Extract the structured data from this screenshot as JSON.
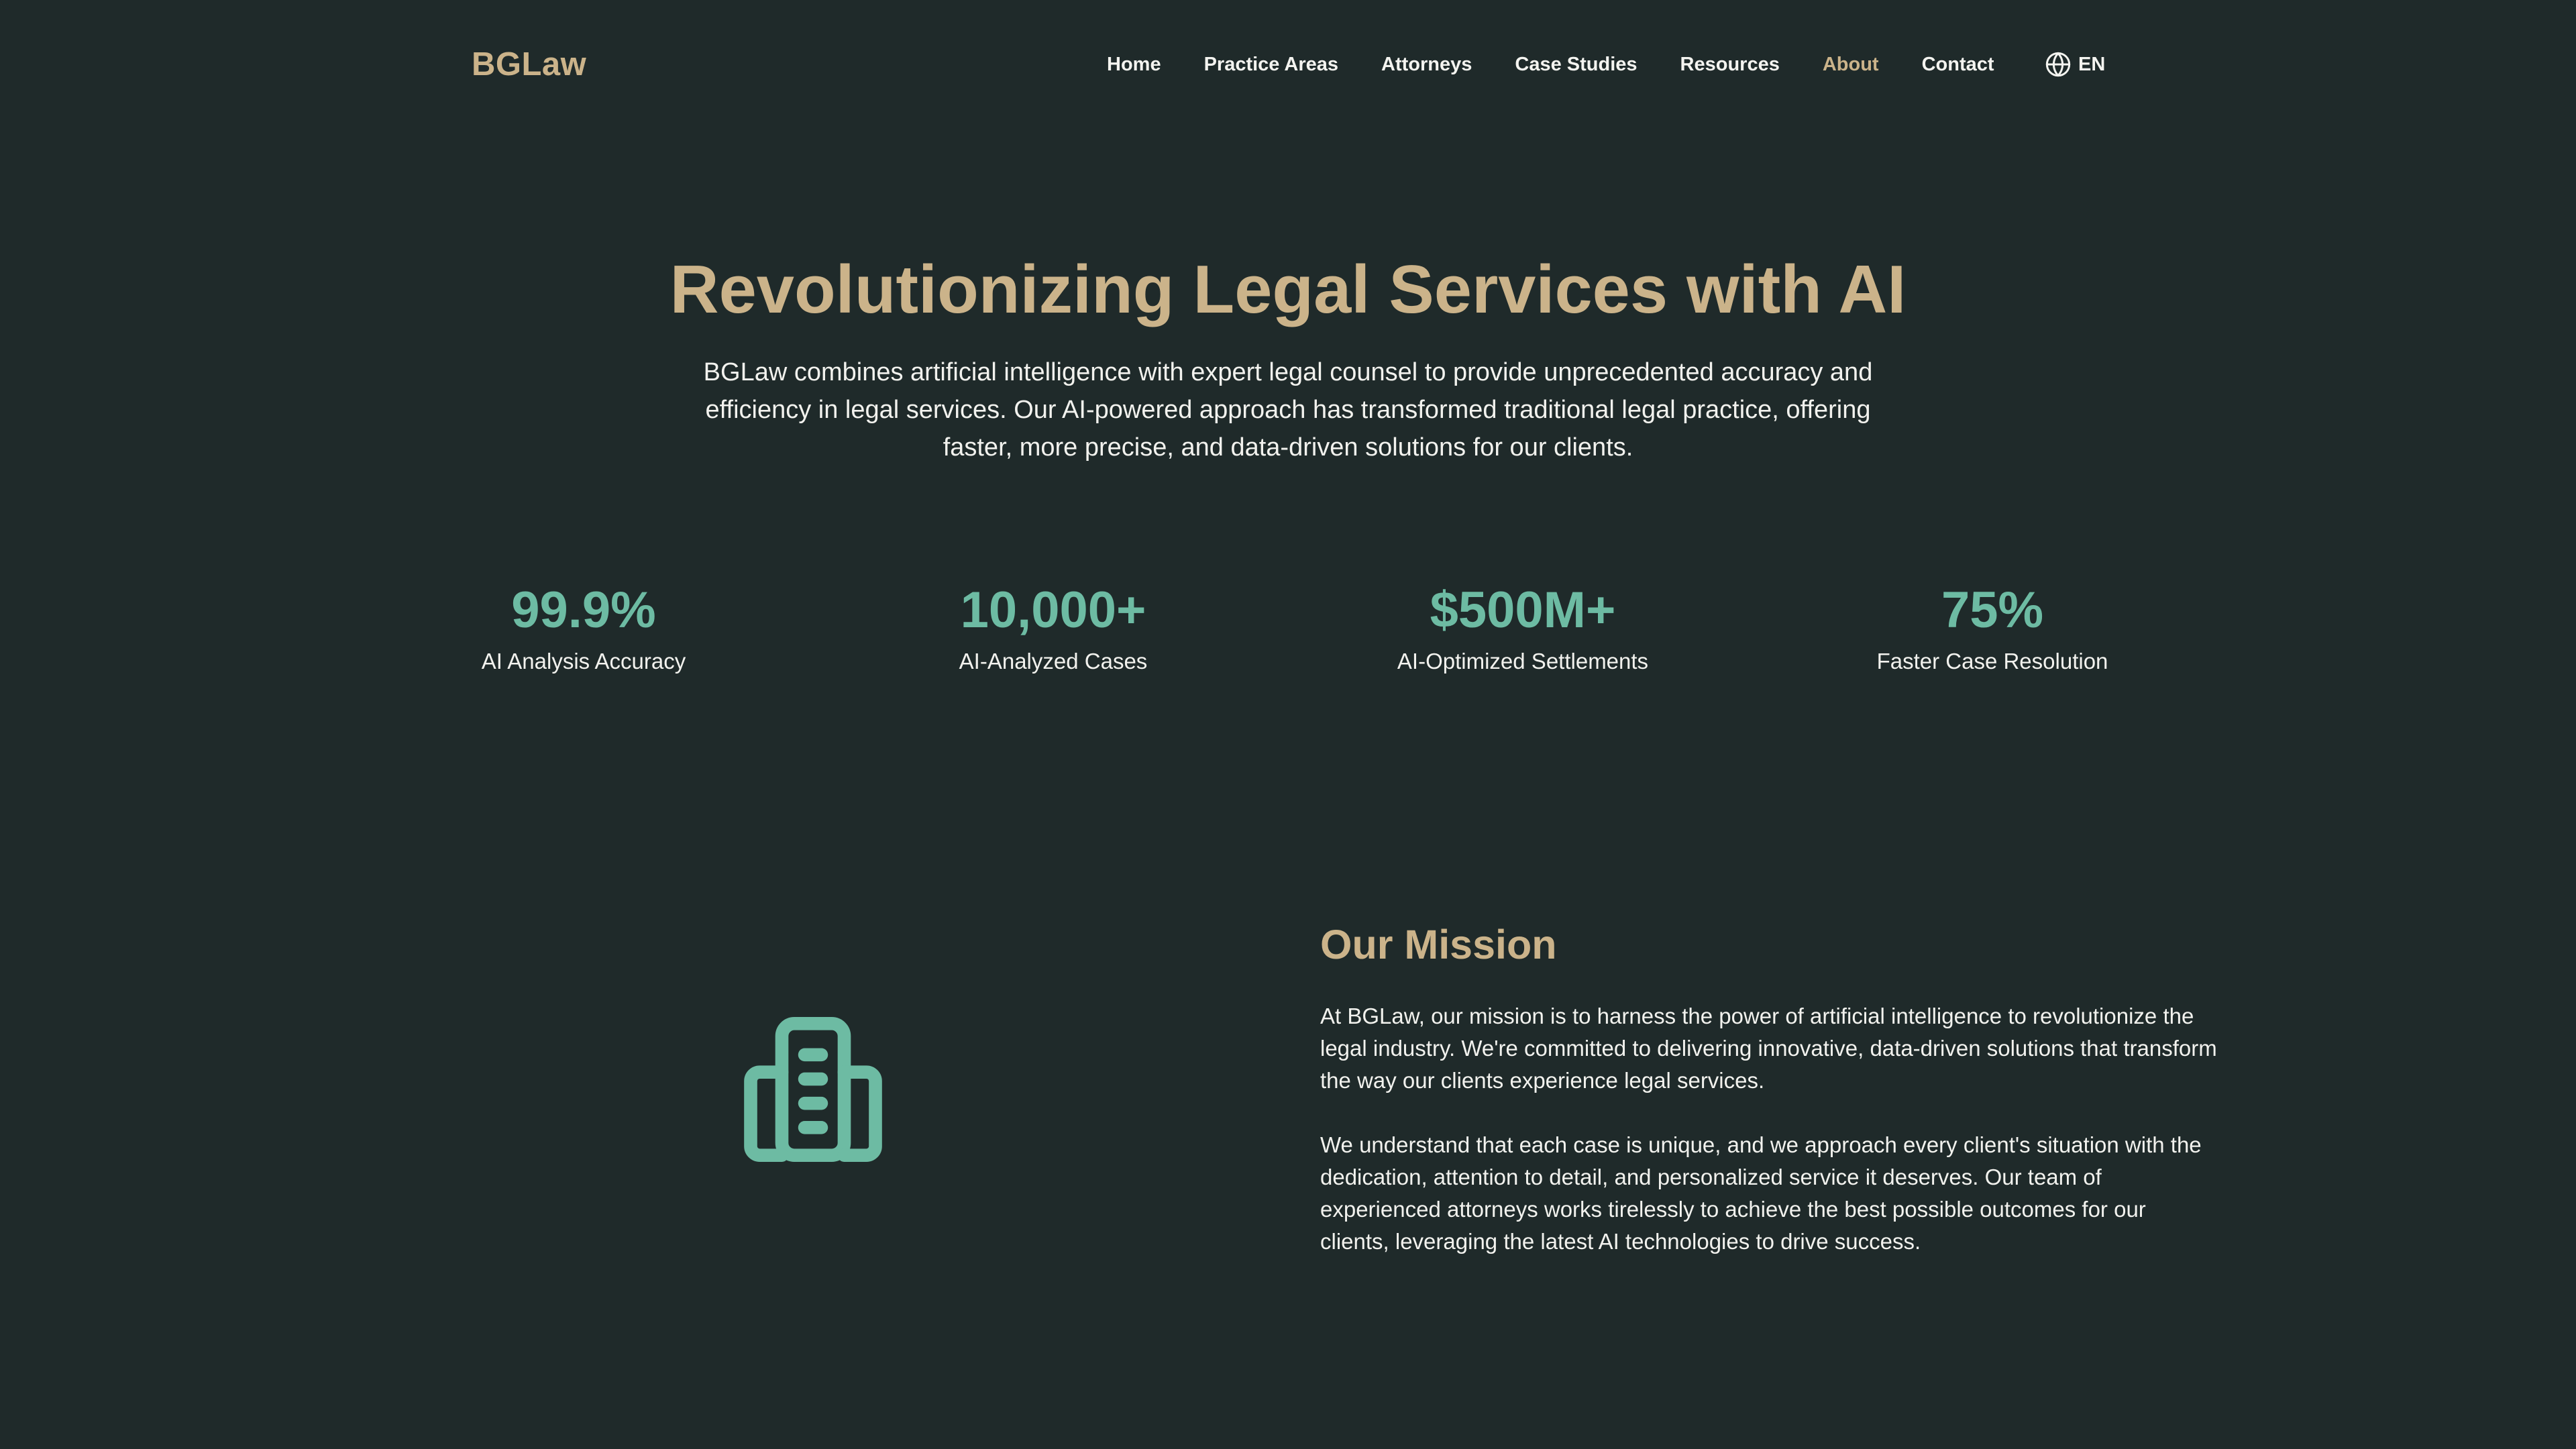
{
  "header": {
    "logo": "BGLaw",
    "nav": [
      {
        "label": "Home",
        "active": false
      },
      {
        "label": "Practice Areas",
        "active": false
      },
      {
        "label": "Attorneys",
        "active": false
      },
      {
        "label": "Case Studies",
        "active": false
      },
      {
        "label": "Resources",
        "active": false
      },
      {
        "label": "About",
        "active": true
      },
      {
        "label": "Contact",
        "active": false
      }
    ],
    "language": {
      "icon": "globe-icon",
      "label": "EN"
    }
  },
  "hero": {
    "title": "Revolutionizing Legal Services with AI",
    "description": "BGLaw combines artificial intelligence with expert legal counsel to provide unprecedented accuracy and efficiency in legal services. Our AI-powered approach has transformed traditional legal practice, offering faster, more precise, and data-driven solutions for our clients."
  },
  "stats": [
    {
      "value": "99.9%",
      "label": "AI Analysis Accuracy"
    },
    {
      "value": "10,000+",
      "label": "AI-Analyzed Cases"
    },
    {
      "value": "$500M+",
      "label": "AI-Optimized Settlements"
    },
    {
      "value": "75%",
      "label": "Faster Case Resolution"
    }
  ],
  "mission": {
    "icon": "building-icon",
    "title": "Our Mission",
    "paragraphs": [
      "At BGLaw, our mission is to harness the power of artificial intelligence to revolutionize the legal industry. We're committed to delivering innovative, data-driven solutions that transform the way our clients experience legal services.",
      "We understand that each case is unique, and we approach every client's situation with the dedication, attention to detail, and personalized service it deserves. Our team of experienced attorneys works tirelessly to achieve the best possible outcomes for our clients, leveraging the latest AI technologies to drive success."
    ]
  },
  "colors": {
    "background": "#1f2a2a",
    "accent_gold": "#cbb38a",
    "accent_teal": "#6dbba3",
    "text": "#f2f2ee"
  }
}
